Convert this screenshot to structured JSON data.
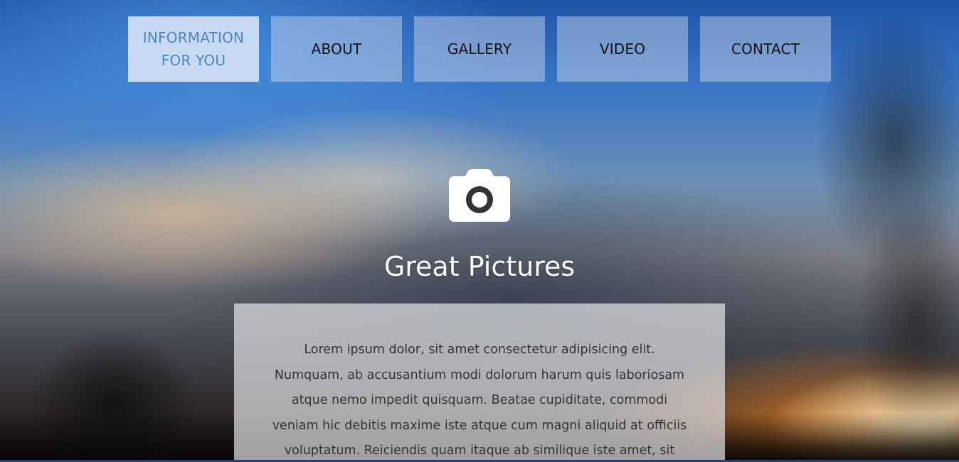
{
  "nav": {
    "items": [
      {
        "label": "INFORMATION FOR YOU",
        "active": true
      },
      {
        "label": "ABOUT",
        "active": false
      },
      {
        "label": "GALLERY",
        "active": false
      },
      {
        "label": "VIDEO",
        "active": false
      },
      {
        "label": "CONTACT",
        "active": false
      }
    ]
  },
  "hero": {
    "icon": "camera-icon",
    "title": "Great Pictures",
    "body": "Lorem ipsum dolor, sit amet consectetur adipisicing elit. Numquam, ab accusantium modi dolorum harum quis laboriosam atque nemo impedit quisquam. Beatae cupiditate, commodi veniam hic debitis maxime iste atque cum magni aliquid at officiis voluptatum. Reiciendis quam itaque ab similique iste amet, sit"
  },
  "colors": {
    "active_nav_text": "#4d86c8",
    "bottom_strip": "#1d3f8a"
  }
}
